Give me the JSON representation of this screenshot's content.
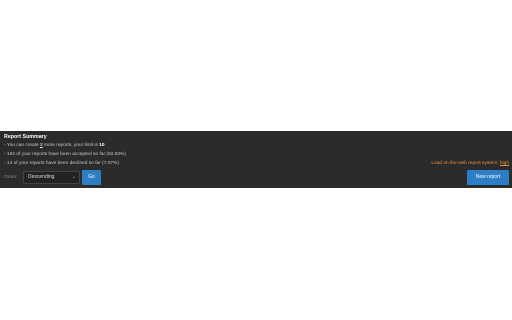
{
  "summary": {
    "title": "Report Summary",
    "line1": {
      "prefix": "- You can create ",
      "remaining": "2",
      "middle": " more reports, your limit is ",
      "limit": "10"
    },
    "line2": "- 184 of your reports have been accepted so far (92.93%)",
    "line3": "- 14 of your reports have been declined so far (7.07%)"
  },
  "load": {
    "label": "Load on the web report system: ",
    "level": "high",
    "color": "#e8963a"
  },
  "controls": {
    "order_label": "Order:",
    "order_value": "Descending",
    "go_label": "Go",
    "new_report_label": "New report",
    "accent": "#2c7fc4"
  }
}
